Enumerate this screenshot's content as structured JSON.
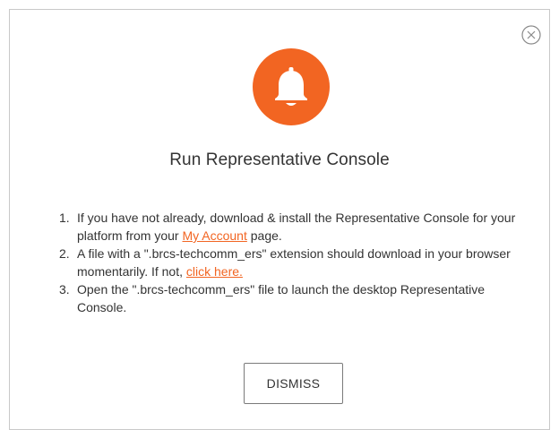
{
  "dialog": {
    "title": "Run Representative Console",
    "steps": [
      {
        "number": "1.",
        "text_before": "If you have not already, download & install the Representative Console for your platform from your ",
        "link": "My Account",
        "text_after": " page."
      },
      {
        "number": "2.",
        "text_before": "A file with a \".brcs-techcomm_ers\" extension should download in your browser momentarily. If not, ",
        "link": "click here.",
        "text_after": ""
      },
      {
        "number": "3.",
        "text_before": "Open the \".brcs-techcomm_ers\" file to launch the desktop Representative Console.",
        "link": "",
        "text_after": ""
      }
    ],
    "dismiss_label": "DISMISS",
    "icons": {
      "close": "close-circle-icon",
      "header": "bell-icon"
    },
    "colors": {
      "accent": "#f26522",
      "text": "#333333",
      "border": "#c9c9c9"
    }
  }
}
